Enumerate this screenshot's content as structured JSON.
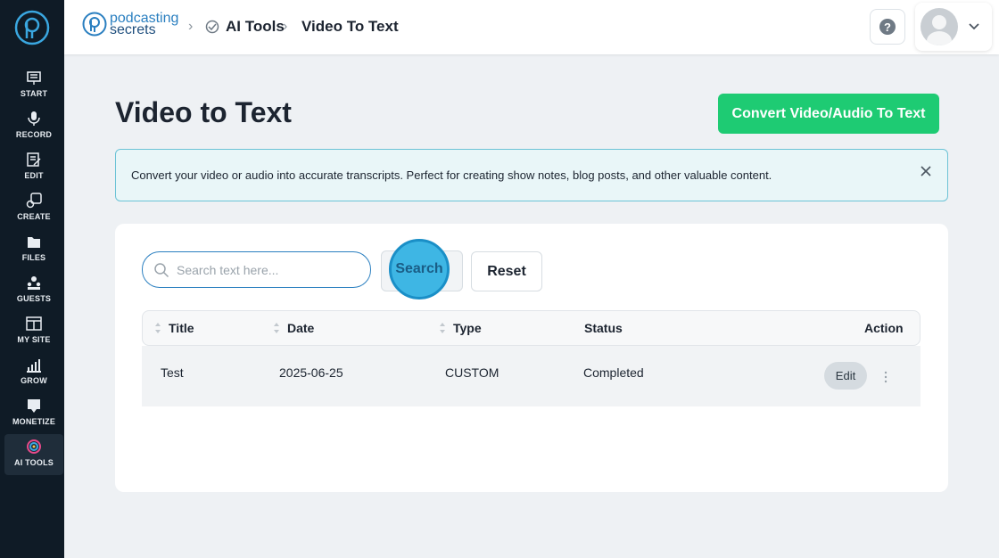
{
  "sidebar": {
    "items": [
      {
        "label": "START",
        "icon": "start-icon"
      },
      {
        "label": "RECORD",
        "icon": "microphone-icon"
      },
      {
        "label": "EDIT",
        "icon": "edit-icon"
      },
      {
        "label": "CREATE",
        "icon": "create-icon"
      },
      {
        "label": "FILES",
        "icon": "files-icon"
      },
      {
        "label": "GUESTS",
        "icon": "guests-icon"
      },
      {
        "label": "MY SITE",
        "icon": "site-icon"
      },
      {
        "label": "GROW",
        "icon": "grow-icon"
      },
      {
        "label": "MONETIZE",
        "icon": "monetize-icon"
      },
      {
        "label": "AI TOOLS",
        "icon": "ai-tools-icon",
        "active": true
      }
    ]
  },
  "header": {
    "brand_line1": "podcasting",
    "brand_line2": "secrets",
    "breadcrumb": [
      "AI Tools",
      "Video To Text"
    ],
    "help_label": "?"
  },
  "main": {
    "title": "Video to Text",
    "convert_button": "Convert Video/Audio To Text",
    "info_text": "Convert your video or audio into accurate transcripts. Perfect for creating show notes, blog posts, and other valuable content.",
    "search_placeholder": "Search text here...",
    "search_button": "Search",
    "reset_button": "Reset",
    "table": {
      "columns": [
        "Title",
        "Date",
        "Type",
        "Status",
        "Action"
      ],
      "rows": [
        {
          "title": "Test",
          "date": "2025-06-25",
          "type": "CUSTOM",
          "status": "Completed",
          "action": "Edit"
        }
      ]
    }
  },
  "colors": {
    "accent": "#2a7fc0",
    "convert": "#1ecb73",
    "sidebar": "#0f1b26"
  }
}
